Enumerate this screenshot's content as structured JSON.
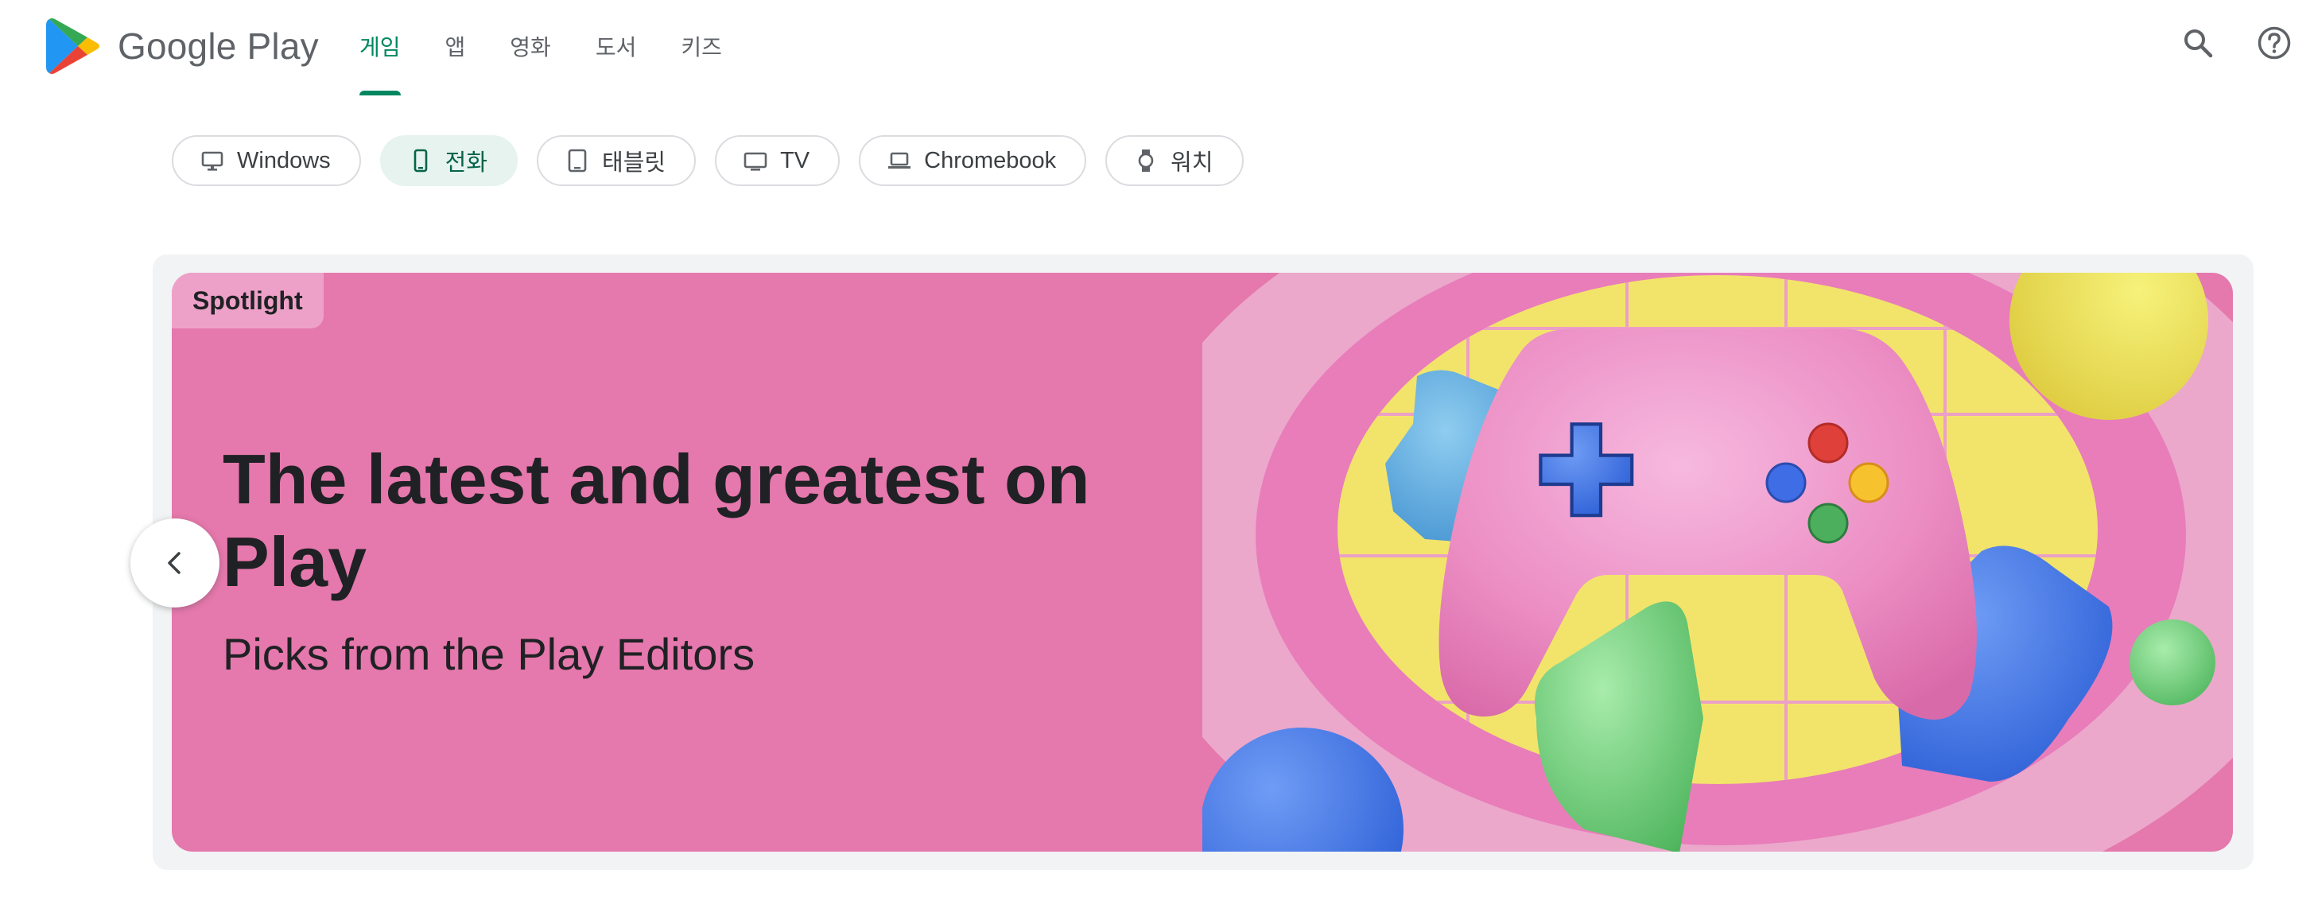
{
  "brand": {
    "name": "Google Play"
  },
  "nav": {
    "tabs": [
      {
        "label": "게임",
        "active": true
      },
      {
        "label": "앱",
        "active": false
      },
      {
        "label": "영화",
        "active": false
      },
      {
        "label": "도서",
        "active": false
      },
      {
        "label": "키즈",
        "active": false
      }
    ]
  },
  "header_icons": [
    "search-icon",
    "help-icon"
  ],
  "devices": {
    "chips": [
      {
        "label": "Windows",
        "icon": "desktop-icon",
        "selected": false
      },
      {
        "label": "전화",
        "icon": "phone-icon",
        "selected": true
      },
      {
        "label": "태블릿",
        "icon": "tablet-icon",
        "selected": false
      },
      {
        "label": "TV",
        "icon": "tv-icon",
        "selected": false
      },
      {
        "label": "Chromebook",
        "icon": "laptop-icon",
        "selected": false
      },
      {
        "label": "워치",
        "icon": "watch-icon",
        "selected": false
      }
    ]
  },
  "spotlight": {
    "tag": "Spotlight",
    "title": "The latest and greatest on Play",
    "subtitle": "Picks from the Play Editors"
  },
  "colors": {
    "accent": "#01875f",
    "banner_background": "#e578ac",
    "chip_selected_background": "#e6f3ef"
  }
}
